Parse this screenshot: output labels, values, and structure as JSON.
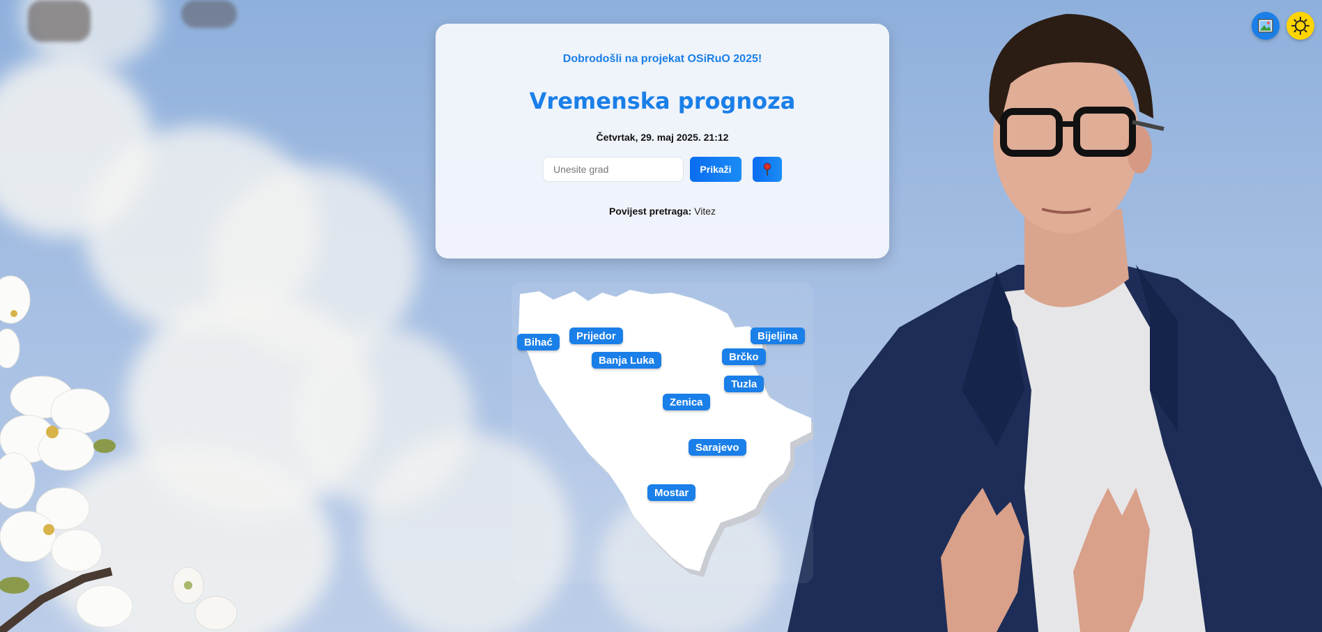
{
  "header": {
    "welcome": "Dobrodošli na projekat OSiRuO 2025!",
    "title": "Vremenska prognoza",
    "datetime": "Četvrtak, 29. maj 2025. 21:12"
  },
  "search": {
    "placeholder": "Unesite grad",
    "value": "",
    "show_label": "Prikaži",
    "locate_icon": "pin-icon"
  },
  "history": {
    "label": "Povijest pretraga:",
    "cities": [
      "Vitez"
    ]
  },
  "toolbar": {
    "background_icon": "image-icon",
    "theme_icon": "sun-icon"
  },
  "map": {
    "cities": [
      "Bihać",
      "Prijedor",
      "Banja Luka",
      "Bijeljina",
      "Brčko",
      "Tuzla",
      "Zenica",
      "Sarajevo",
      "Mostar"
    ]
  },
  "colors": {
    "accent": "#1a7fe8",
    "theme_button": "#ffd400"
  }
}
